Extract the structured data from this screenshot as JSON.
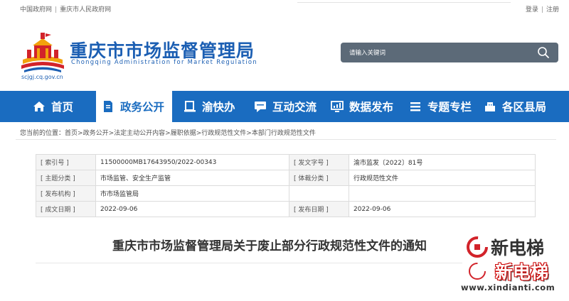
{
  "topbar": {
    "links": [
      "中国政府网",
      "重庆市人民政府网"
    ],
    "login": "登录",
    "register": "注册"
  },
  "header": {
    "title_cn": "重庆市市场监督管理局",
    "title_en": "Chongqing Administration for Market Regulation",
    "domain": "scjgj.cq.gov.cn",
    "search_placeholder": "请输入关键词"
  },
  "nav": {
    "items": [
      {
        "label": "首页",
        "icon": "home-icon"
      },
      {
        "label": "政务公开",
        "icon": "document-icon",
        "active": true
      },
      {
        "label": "渝快办",
        "icon": "service-icon"
      },
      {
        "label": "互动交流",
        "icon": "chat-icon"
      },
      {
        "label": "数据发布",
        "icon": "monitor-icon"
      },
      {
        "label": "专题专栏",
        "icon": "list-icon"
      },
      {
        "label": "各区县局",
        "icon": "building-icon"
      }
    ]
  },
  "breadcrumb": {
    "prefix": "您当前的位置：",
    "path": [
      "首页",
      "政务公开",
      "法定主动公开内容",
      "履职依据",
      "行政规范性文件",
      "本部门行政规范性文件"
    ]
  },
  "meta": [
    [
      "[ 索引号 ]",
      "11500000MB17643950/2022-00343",
      "[ 发文字号 ]",
      "渝市监发〔2022〕81号"
    ],
    [
      "[ 主题分类 ]",
      "市场监管、安全生产监管",
      "[ 体裁分类 ]",
      "行政规范性文件"
    ],
    [
      "[ 发布机构 ]",
      "市市场监管局",
      "",
      ""
    ],
    [
      "[ 成文日期 ]",
      "2022-09-06",
      "[ 发布日期 ]",
      "2022-09-06"
    ]
  ],
  "doc": {
    "title": "重庆市市场监督管理局关于废止部分行政规范性文件的通知"
  },
  "watermark": {
    "text1": "新电梯",
    "text2": "新电梯",
    "url": "www.xindianti.com"
  },
  "colors": {
    "brand_blue": "#1a6cc0",
    "search_bg": "#5c6a78",
    "table_label_bg": "#f4f4f4"
  }
}
